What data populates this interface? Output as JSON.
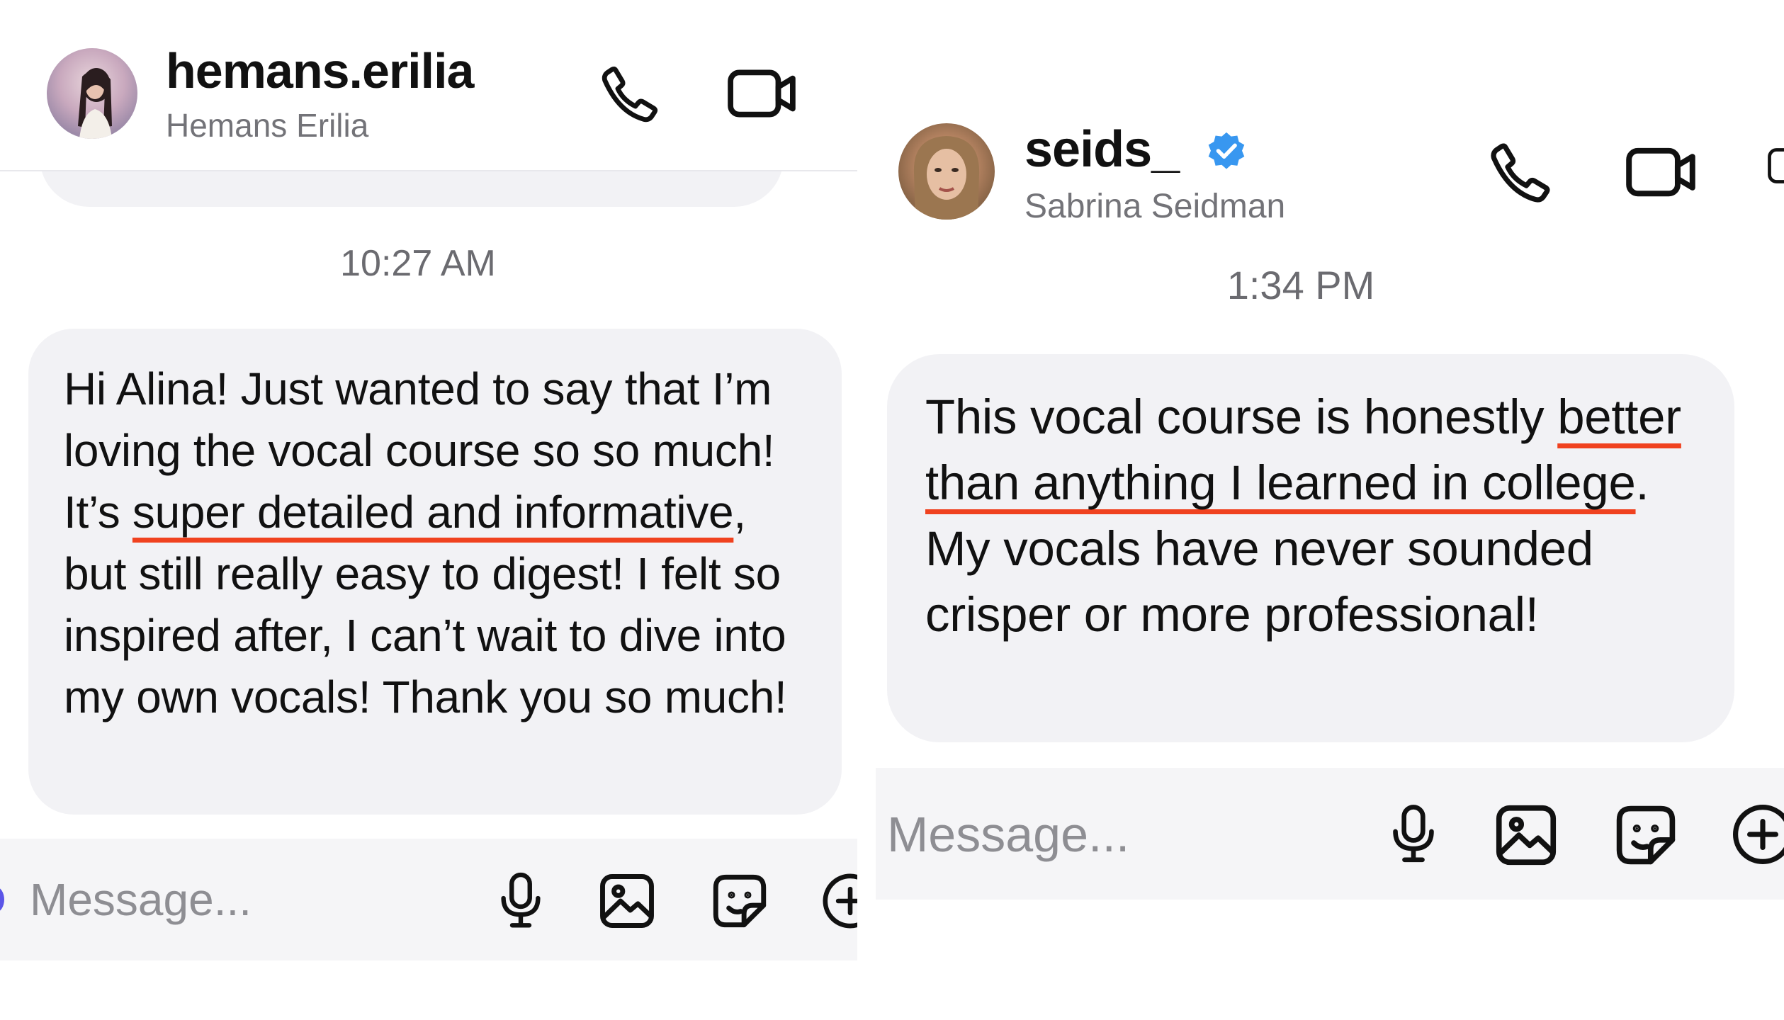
{
  "left_chat": {
    "header": {
      "username": "hemans.erilia",
      "full_name": "Hemans Erilia",
      "avatar_icon": "profile-photo-woman-dark-hair"
    },
    "timestamp": "10:27 AM",
    "message": {
      "before": "Hi Alina! Just wanted to say that I’m loving the vocal course so so much! It’s ",
      "highlight": "super detailed and informative",
      "after": ", but still really easy to digest! I felt so inspired after, I can’t wait to dive into my own vocals! Thank you so much!"
    },
    "composer": {
      "placeholder": "Message..."
    }
  },
  "right_chat": {
    "header": {
      "username": "seids_",
      "full_name": "Sabrina Seidman",
      "verified": true,
      "avatar_icon": "profile-photo-woman-blonde-hair"
    },
    "timestamp": "1:34 PM",
    "message": {
      "before": "This vocal course is honestly ",
      "highlight": "better than anything I learned in college",
      "after": ". My vocals have never sounded crisper or more professional!"
    },
    "composer": {
      "placeholder": "Message..."
    }
  },
  "icons": {
    "header": [
      "phone-icon",
      "video-camera-icon"
    ],
    "composer": [
      "microphone-icon",
      "image-icon",
      "sticker-icon",
      "plus-icon"
    ]
  },
  "colors": {
    "highlight_underline": "#f0421f",
    "bubble_background": "#f2f2f5",
    "verified_badge": "#3897f0",
    "secondary_text": "#737378",
    "placeholder_text": "#8e8e93"
  }
}
